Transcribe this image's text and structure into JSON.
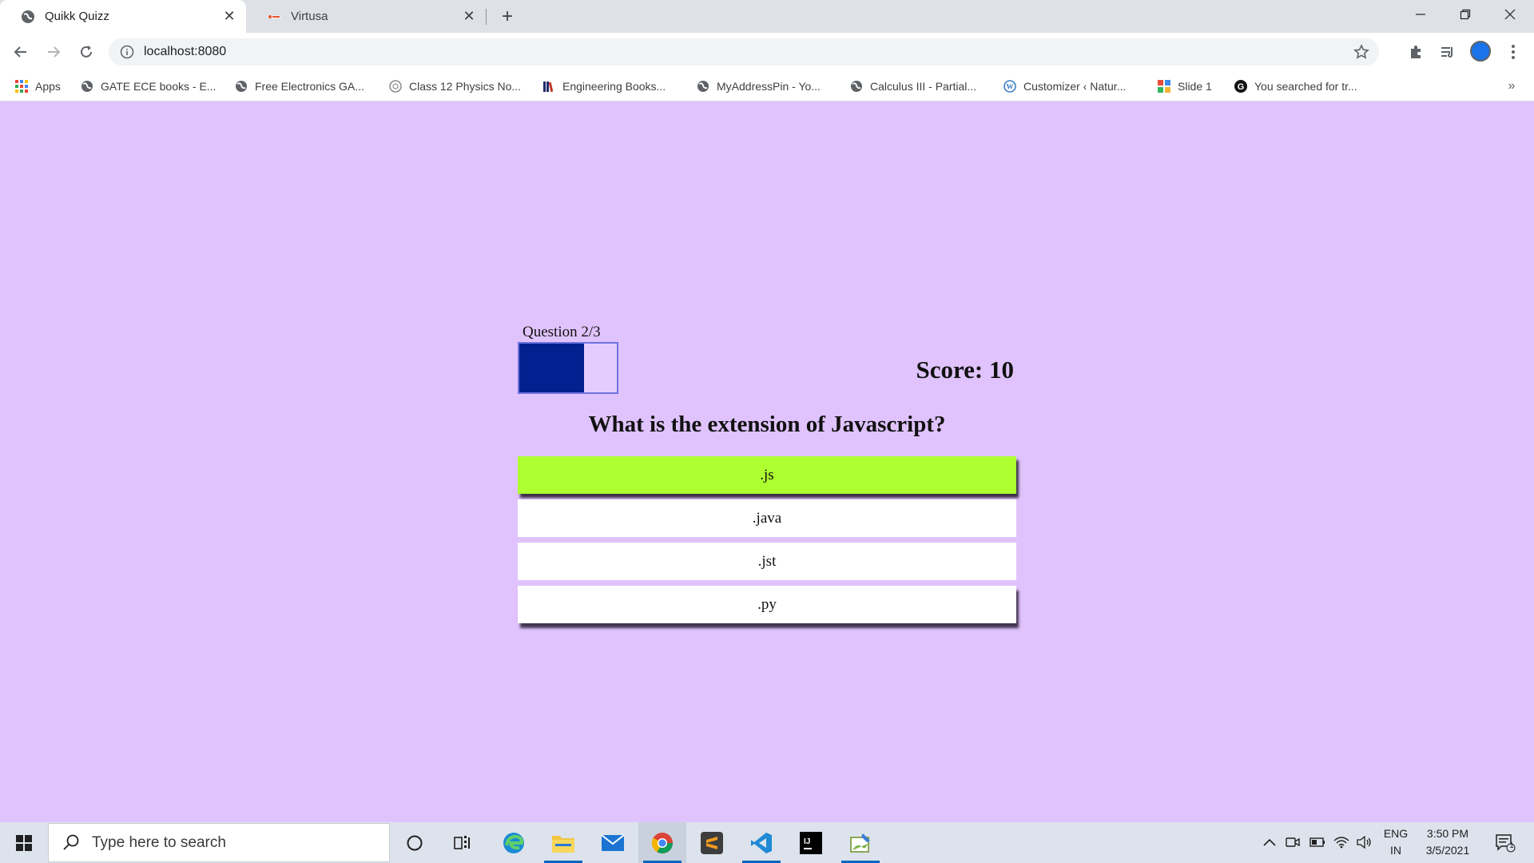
{
  "browser": {
    "tabs": [
      {
        "title": "Quikk Quizz",
        "active": true
      },
      {
        "title": "Virtusa",
        "active": false
      }
    ],
    "url": "localhost:8080",
    "bookmarks": [
      {
        "label": "Apps",
        "icon": "apps-grid-icon"
      },
      {
        "label": "GATE ECE books - E...",
        "icon": "globe-icon"
      },
      {
        "label": "Free Electronics GA...",
        "icon": "globe-icon"
      },
      {
        "label": "Class 12 Physics No...",
        "icon": "site-icon"
      },
      {
        "label": "Engineering Books...",
        "icon": "books-icon"
      },
      {
        "label": "MyAddressPin - Yo...",
        "icon": "globe-icon"
      },
      {
        "label": "Calculus III - Partial...",
        "icon": "globe-icon"
      },
      {
        "label": "Customizer ‹ Natur...",
        "icon": "wordpress-icon"
      },
      {
        "label": "Slide 1",
        "icon": "slide-icon"
      },
      {
        "label": "You searched for tr...",
        "icon": "g-icon"
      }
    ],
    "more_bookmarks": "»"
  },
  "quiz": {
    "question_counter": "Question 2/3",
    "progress_fraction": 0.667,
    "score": "Score: 10",
    "question": "What is the extension of Javascript?",
    "options": [
      ".js",
      ".java",
      ".jst",
      ".py"
    ],
    "correct_option_index": 0,
    "colors": {
      "background": "#e0c3fc",
      "progress_fill": "#00218f",
      "correct_answer": "#adff2f",
      "option_background": "#ffffff"
    }
  },
  "taskbar": {
    "search_placeholder": "Type here to search",
    "language": "ENG",
    "region": "IN",
    "time": "3:50 PM",
    "date": "3/5/2021",
    "notification_count": "1"
  }
}
